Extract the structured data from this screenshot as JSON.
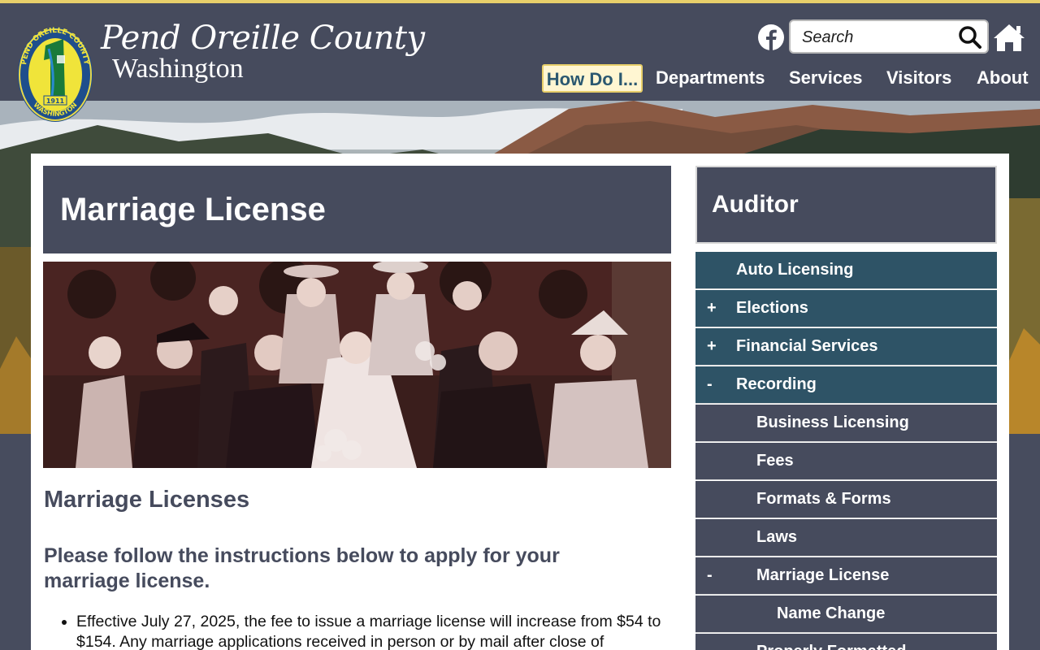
{
  "header": {
    "brand_script": "Pend Oreille County",
    "brand_state": "Washington",
    "seal_text_top": "PEND OREILLE COUNTY",
    "seal_text_bottom": "WASHINGTON",
    "seal_year": "1911",
    "search_placeholder": "Search",
    "nav": [
      {
        "label": "How Do I..."
      },
      {
        "label": "Departments"
      },
      {
        "label": "Services"
      },
      {
        "label": "Visitors"
      },
      {
        "label": "About"
      }
    ],
    "icons": {
      "facebook": "facebook-icon",
      "search": "magnifier-icon",
      "home": "home-icon"
    }
  },
  "page": {
    "title": "Marriage License",
    "section_title": "Marriage Licenses",
    "instructions": "Please follow the instructions below to apply for your marriage license.",
    "bullets": [
      "Effective July 27, 2025, the fee to issue a marriage license will increase from $54 to $154. Any marriage applications received in person or by mail after close of"
    ]
  },
  "sidebar": {
    "department": "Auditor",
    "items": [
      {
        "label": "Auto Licensing",
        "toggle": ""
      },
      {
        "label": "Elections",
        "toggle": "+"
      },
      {
        "label": "Financial Services",
        "toggle": "+"
      },
      {
        "label": "Recording",
        "toggle": "-"
      },
      {
        "label": "Business Licensing",
        "toggle": ""
      },
      {
        "label": "Fees",
        "toggle": ""
      },
      {
        "label": "Formats & Forms",
        "toggle": ""
      },
      {
        "label": "Laws",
        "toggle": ""
      },
      {
        "label": "Marriage License",
        "toggle": "-"
      },
      {
        "label": "Name Change",
        "toggle": ""
      },
      {
        "label": "Properly Formatted",
        "toggle": ""
      }
    ]
  },
  "colors": {
    "header_bg": "#464b5d",
    "accent_yellow": "#e8cf6a",
    "sidebar_teal": "#2e5366",
    "sidebar_slate": "#464b5d",
    "howdo_bg": "#fff6d2"
  }
}
